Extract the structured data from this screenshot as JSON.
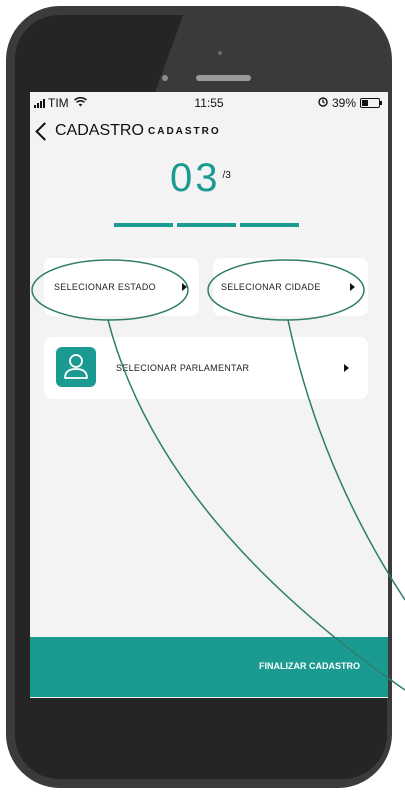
{
  "status_bar": {
    "carrier": "TIM",
    "time": "11:55",
    "battery": "39%"
  },
  "nav": {
    "back_label": "CADASTRO",
    "title": "CADASTRO"
  },
  "step": {
    "current": "03",
    "total": "/3"
  },
  "progress": {
    "completed_steps": 3,
    "total_steps": 3
  },
  "cards": {
    "estado_label": "SELECIONAR ESTADO",
    "cidade_label": "SELECIONAR CIDADE",
    "parlamentar_label": "SELECIONAR PARLAMENTAR"
  },
  "footer": {
    "finish_label": "FINALIZAR CADASTRO"
  },
  "colors": {
    "accent": "#1b9a92",
    "annotation": "#2e7d6a"
  },
  "icons": [
    "signal-icon",
    "wifi-icon",
    "alarm-icon",
    "battery-icon",
    "chevron-left-icon",
    "triangle-right-icon",
    "user-icon"
  ]
}
